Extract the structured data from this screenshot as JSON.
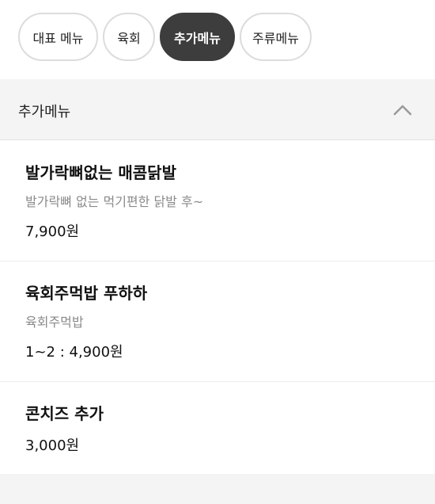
{
  "category_chips": [
    {
      "label": "대표 메뉴",
      "active": false
    },
    {
      "label": "육회",
      "active": false
    },
    {
      "label": "추가메뉴",
      "active": true
    },
    {
      "label": "주류메뉴",
      "active": false
    }
  ],
  "section": {
    "title": "추가메뉴",
    "collapse_icon": "chevron-up-icon"
  },
  "menu_items": [
    {
      "name": "발가락뼈없는 매콤닭발",
      "description": "발가락뼈 없는 먹기편한 닭발 후~",
      "price": "7,900원"
    },
    {
      "name": "육회주먹밥 푸하하",
      "description": "육회주먹밥",
      "price": "1~2 : 4,900원"
    },
    {
      "name": "콘치즈 추가",
      "description": "",
      "price": "3,000원"
    }
  ],
  "colors": {
    "active_chip": "#3d3d3d",
    "chip_border": "#dcdcdc",
    "section_bg": "#f4f4f4",
    "description_text": "#8a8a8a"
  }
}
